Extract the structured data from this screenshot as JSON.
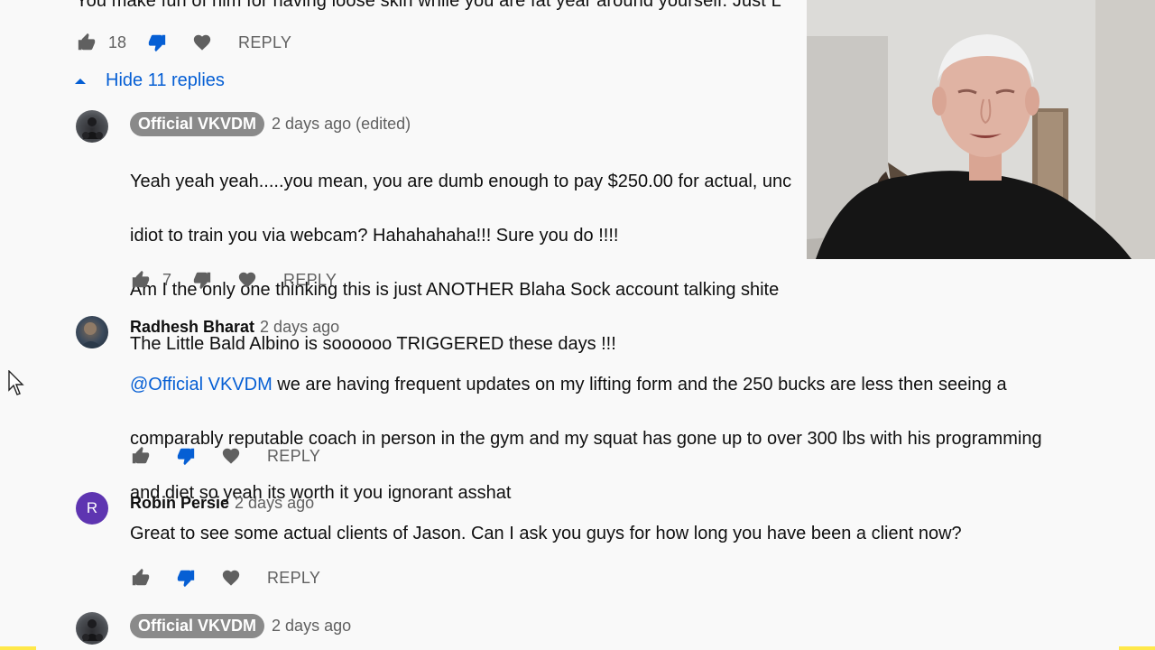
{
  "top_comment": {
    "cut_text": "You make fun of him for having loose skin while you are fat year around yourself. Just L",
    "likes": "18",
    "reply_label": "REPLY"
  },
  "hide_replies_label": "Hide 11 replies",
  "replies": [
    {
      "author": "Official VKVDM",
      "timestamp": "2 days ago (edited)",
      "lines": [
        "Yeah yeah yeah.....you mean, you are dumb enough to pay $250.00 for actual, unc",
        "idiot to train you via webcam?  Hahahahaha!!! Sure you do !!!!",
        "Am I the only one thinking this is just ANOTHER Blaha Sock account talking shite",
        "The Little Bald Albino is soooooo TRIGGERED these days !!!"
      ],
      "likes": "7",
      "reply_label": "REPLY"
    },
    {
      "author": "Radhesh Bharat",
      "timestamp": "2 days ago",
      "mention": "@Official VKVDM",
      "line1_rest": " we are having frequent updates on my lifting form and the 250 bucks are less then seeing a",
      "line2": "comparably reputable coach in person in the gym and my squat has gone up to over 300 lbs with his programming",
      "line3": "and diet so yeah its worth it you ignorant asshat",
      "reply_label": "REPLY"
    },
    {
      "author": "Robin Persie",
      "avatar_letter": "R",
      "timestamp": "2 days ago",
      "text": "Great to see some actual clients of Jason.  Can I ask you guys for how long you have been a client now?",
      "reply_label": "REPLY"
    },
    {
      "author": "Official VKVDM",
      "timestamp": "2 days ago"
    }
  ],
  "colors": {
    "link_blue": "#065fd4",
    "dislike_active": "#065fd4",
    "icon_gray": "#606060",
    "chip_gray": "#8a8a8a",
    "avatar_purple": "#5e35b1",
    "background": "#f9f9f9"
  }
}
